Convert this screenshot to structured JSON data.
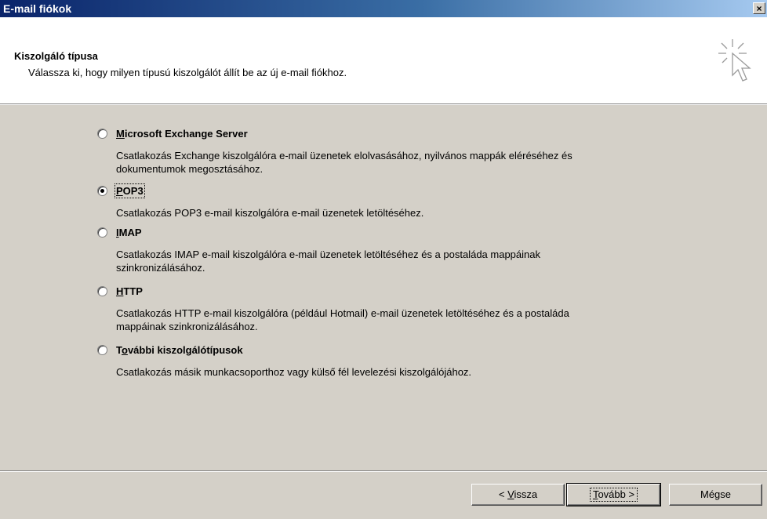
{
  "window": {
    "title": "E-mail fiókok",
    "close_label": "×"
  },
  "header": {
    "title": "Kiszolgáló típusa",
    "subtitle": "Válassza ki, hogy milyen típusú kiszolgálót állít be az új e-mail fiókhoz."
  },
  "options": [
    {
      "pre": "",
      "key": "M",
      "post": "icrosoft Exchange Server",
      "selected": false,
      "desc": "Csatlakozás Exchange kiszolgálóra e-mail üzenetek elolvasásához, nyilvános mappák eléréséhez és dokumentumok megosztásához."
    },
    {
      "pre": "",
      "key": "P",
      "post": "OP3",
      "selected": true,
      "desc": "Csatlakozás POP3 e-mail kiszolgálóra e-mail üzenetek letöltéséhez."
    },
    {
      "pre": "",
      "key": "I",
      "post": "MAP",
      "selected": false,
      "desc": "Csatlakozás IMAP e-mail kiszolgálóra e-mail üzenetek letöltéséhez és a postaláda mappáinak szinkronizálásához."
    },
    {
      "pre": "",
      "key": "H",
      "post": "TTP",
      "selected": false,
      "desc": "Csatlakozás HTTP e-mail kiszolgálóra (például Hotmail) e-mail üzenetek letöltéséhez és a postaláda mappáinak szinkronizálásához."
    },
    {
      "pre": "T",
      "key": "o",
      "post": "vábbi kiszolgálótípusok",
      "selected": false,
      "desc": "Csatlakozás másik munkacsoporthoz vagy külső fél levelezési kiszolgálójához."
    }
  ],
  "buttons": {
    "back": {
      "pre": "< ",
      "key": "V",
      "post": "issza"
    },
    "next": {
      "pre": "",
      "key": "T",
      "post": "ovább >"
    },
    "cancel": {
      "label": "Mégse"
    }
  }
}
